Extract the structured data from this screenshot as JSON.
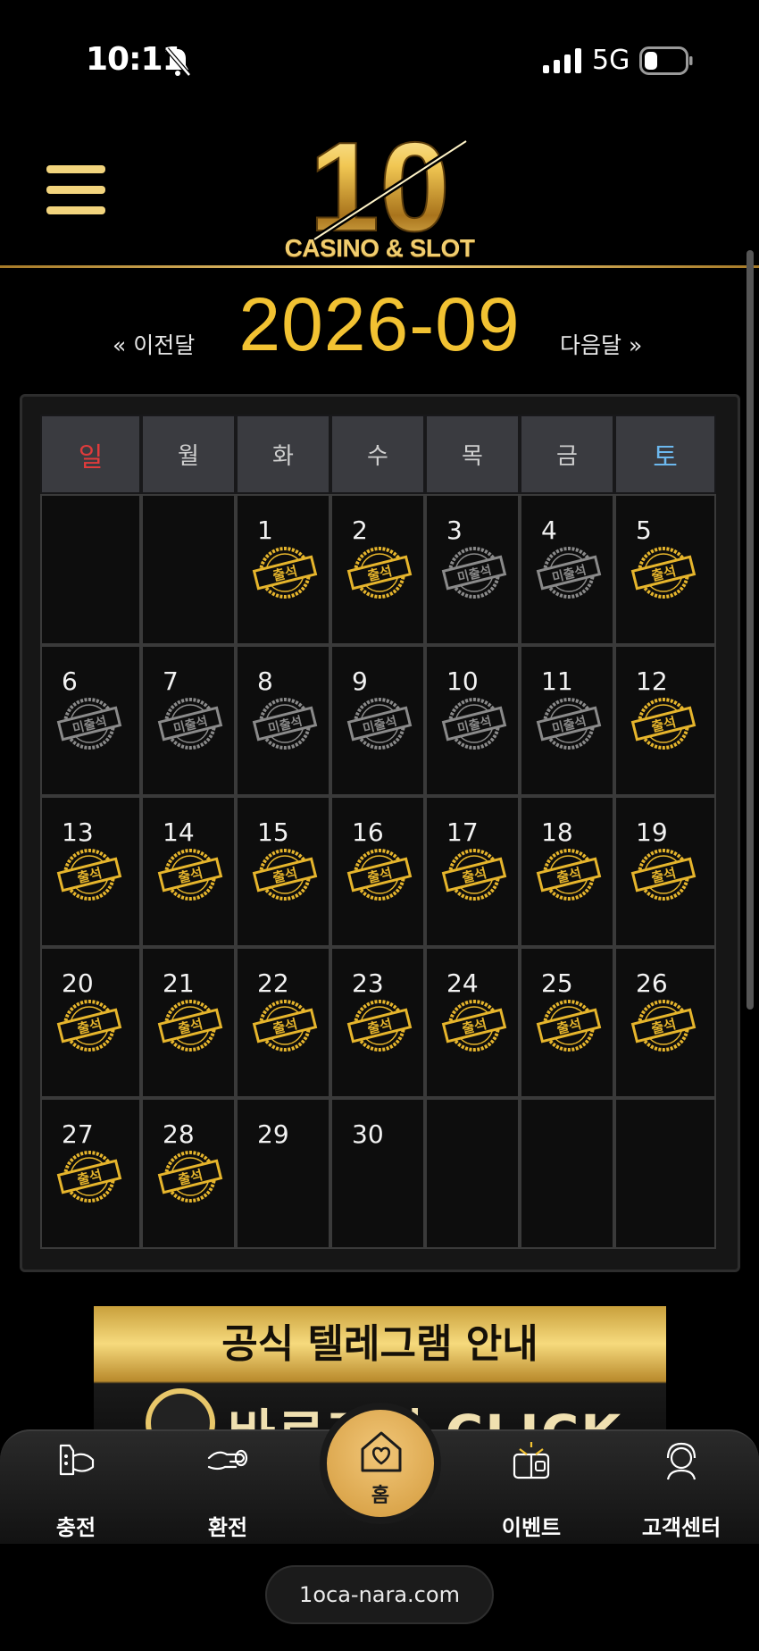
{
  "status_bar": {
    "time": "10:11",
    "network": "5G",
    "bell_icon": "bell-slash-icon",
    "signal_icon": "signal-icon",
    "battery_icon": "battery-icon"
  },
  "header": {
    "menu_icon": "hamburger-menu-icon",
    "logo_number": "10",
    "logo_text": "CASINO & SLOT"
  },
  "month_nav": {
    "prev_label": "« 이전달",
    "title": "2026-09",
    "next_label": "다음달 »"
  },
  "calendar": {
    "weekdays": [
      "일",
      "월",
      "화",
      "수",
      "목",
      "금",
      "토"
    ],
    "weeks": [
      [
        {
          "day": "",
          "status": ""
        },
        {
          "day": "",
          "status": ""
        },
        {
          "day": "1",
          "status": "출석"
        },
        {
          "day": "2",
          "status": "출석"
        },
        {
          "day": "3",
          "status": "미출석"
        },
        {
          "day": "4",
          "status": "미출석"
        },
        {
          "day": "5",
          "status": "출석"
        }
      ],
      [
        {
          "day": "6",
          "status": "미출석"
        },
        {
          "day": "7",
          "status": "미출석"
        },
        {
          "day": "8",
          "status": "미출석"
        },
        {
          "day": "9",
          "status": "미출석"
        },
        {
          "day": "10",
          "status": "미출석"
        },
        {
          "day": "11",
          "status": "미출석"
        },
        {
          "day": "12",
          "status": "출석"
        }
      ],
      [
        {
          "day": "13",
          "status": "출석"
        },
        {
          "day": "14",
          "status": "출석"
        },
        {
          "day": "15",
          "status": "출석"
        },
        {
          "day": "16",
          "status": "출석"
        },
        {
          "day": "17",
          "status": "출석"
        },
        {
          "day": "18",
          "status": "출석"
        },
        {
          "day": "19",
          "status": "출석"
        }
      ],
      [
        {
          "day": "20",
          "status": "출석"
        },
        {
          "day": "21",
          "status": "출석"
        },
        {
          "day": "22",
          "status": "출석"
        },
        {
          "day": "23",
          "status": "출석"
        },
        {
          "day": "24",
          "status": "출석"
        },
        {
          "day": "25",
          "status": "출석"
        },
        {
          "day": "26",
          "status": "출석"
        }
      ],
      [
        {
          "day": "27",
          "status": "출석"
        },
        {
          "day": "28",
          "status": "출석"
        },
        {
          "day": "29",
          "status": ""
        },
        {
          "day": "30",
          "status": ""
        },
        {
          "day": "",
          "status": ""
        },
        {
          "day": "",
          "status": ""
        },
        {
          "day": "",
          "status": ""
        }
      ]
    ]
  },
  "banner": {
    "title": "공식 텔레그램 안내",
    "subtitle": "바로가기 CLICK"
  },
  "bottom_nav": {
    "items": [
      {
        "label": "충전",
        "icon": "charge-icon"
      },
      {
        "label": "환전",
        "icon": "exchange-icon"
      },
      {
        "label": "이벤트",
        "icon": "gift-icon"
      },
      {
        "label": "고객센터",
        "icon": "support-icon"
      }
    ],
    "home": {
      "label": "홈",
      "icon": "home-heart-icon"
    }
  },
  "url": "1oca-nara.com",
  "colors": {
    "gold": "#f2c232",
    "attended": "#e6b52c",
    "absent": "#8a8a8a",
    "sunday": "#e03b3b",
    "saturday": "#6cb8ee"
  }
}
